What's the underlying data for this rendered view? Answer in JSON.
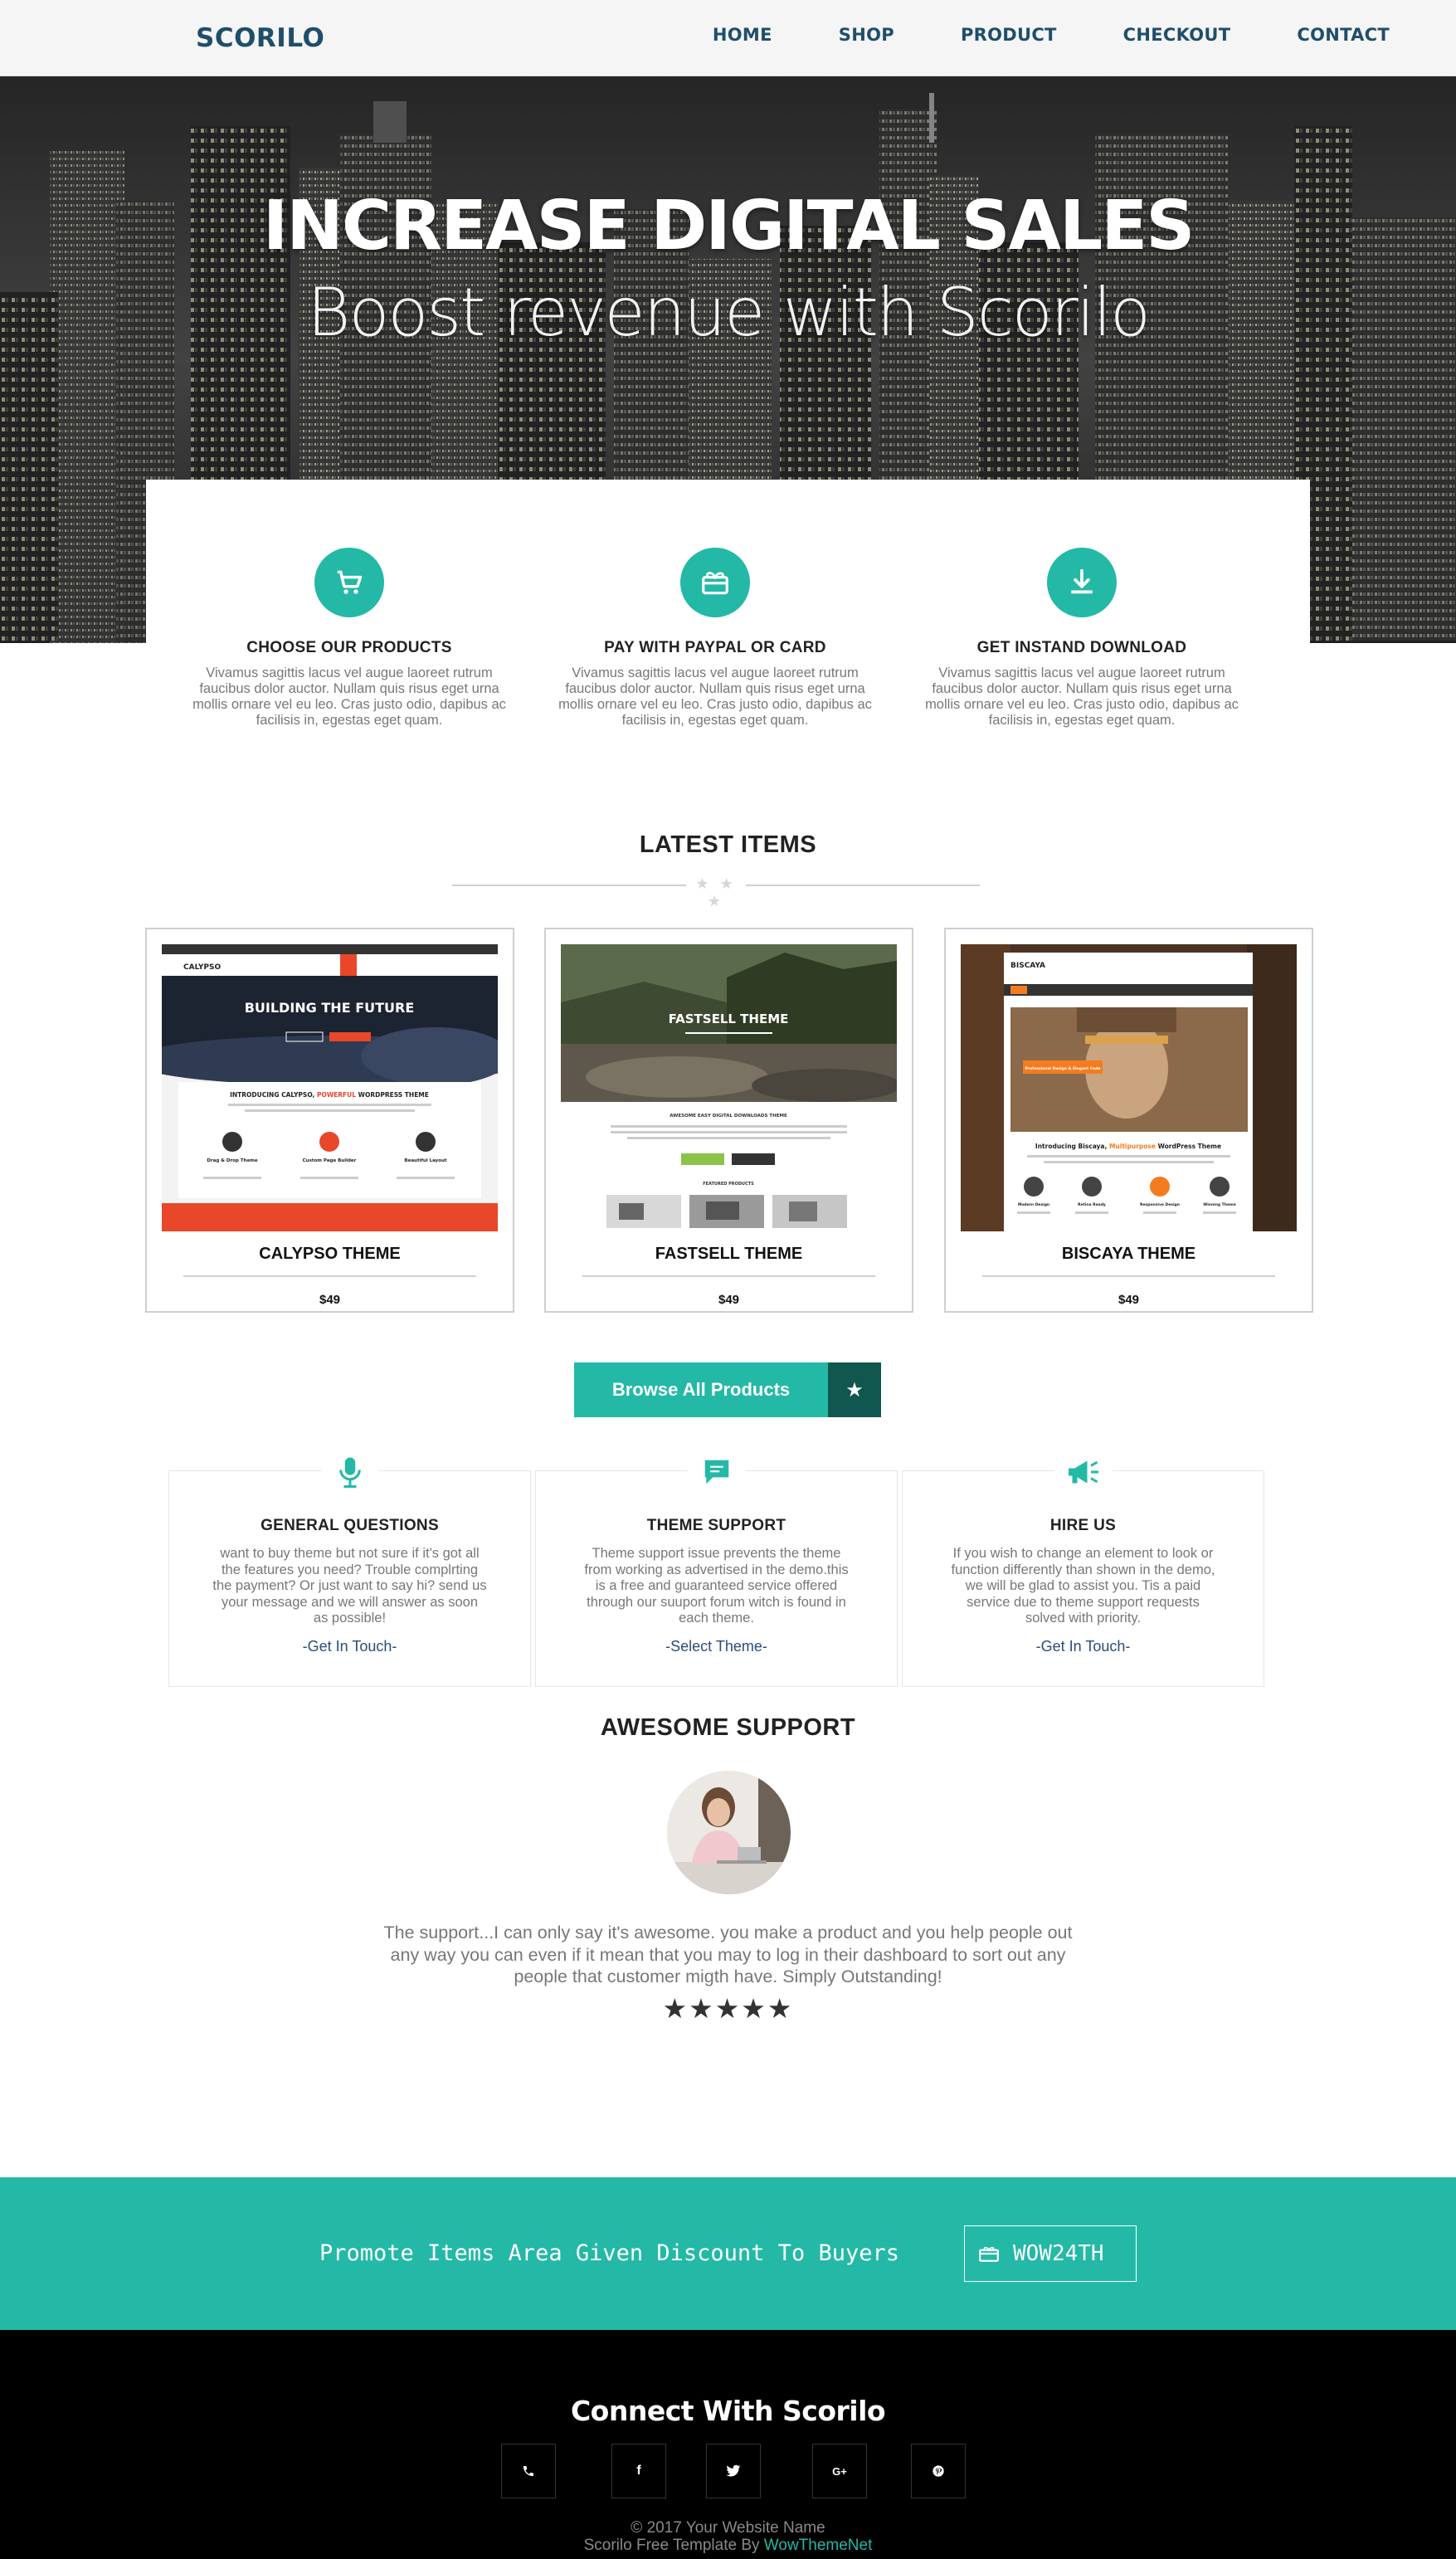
{
  "nav": {
    "brand": "SCORILO",
    "items": [
      "HOME",
      "SHOP",
      "PRODUCT",
      "CHECKOUT",
      "CONTACT"
    ]
  },
  "hero": {
    "title": "INCREASE DIGITAL SALES",
    "subtitle": "Boost revenue with Scorilo"
  },
  "features": [
    {
      "icon": "cart-icon",
      "title": "CHOOSE OUR PRODUCTS",
      "text": "Vivamus sagittis lacus vel augue laoreet rutrum faucibus dolor auctor. Nullam quis risus eget urna mollis ornare vel eu leo. Cras justo odio, dapibus ac facilisis in, egestas eget quam."
    },
    {
      "icon": "gift-icon",
      "title": "PAY WITH PAYPAL OR CARD",
      "text": "Vivamus sagittis lacus vel augue laoreet rutrum faucibus dolor auctor. Nullam quis risus eget urna mollis ornare vel eu leo. Cras justo odio, dapibus ac facilisis in, egestas eget quam."
    },
    {
      "icon": "download-icon",
      "title": "GET INSTAND DOWNLOAD",
      "text": "Vivamus sagittis lacus vel augue laoreet rutrum faucibus dolor auctor. Nullam quis risus eget urna mollis ornare vel eu leo. Cras justo odio, dapibus ac facilisis in, egestas eget quam."
    }
  ],
  "latest": {
    "title": "LATEST ITEMS",
    "stars": "★ ★ ★",
    "products": [
      {
        "name": "CALYPSO THEME",
        "price": "$49",
        "preview": {
          "logo": "CALYPSO",
          "banner": "BUILDING THE FUTURE",
          "heading_pre": "INTRODUCING CALYPSO, ",
          "heading_hl": "POWERFUL",
          "heading_post": " WORDPRESS THEME",
          "blocks": [
            "Drag & Drop Theme",
            "Custom Page Builder",
            "Beautiful Layout"
          ]
        }
      },
      {
        "name": "FASTSELL THEME",
        "price": "$49",
        "preview": {
          "banner": "FASTSELL THEME",
          "heading": "AWESOME EASY DIGITAL DOWNLOADS THEME",
          "section": "FEATURED PRODUCTS"
        }
      },
      {
        "name": "BISCAYA THEME",
        "price": "$49",
        "preview": {
          "logo": "BISCAYA",
          "ribbon": "Professional Design & Elegant Code",
          "heading_pre": "Introducing Biscaya, ",
          "heading_hl": "Multipurpose",
          "heading_post": " WordPress Theme",
          "blocks": [
            "Modern Design",
            "Retina Ready",
            "Responsive Design",
            "Winning Theme"
          ]
        }
      }
    ]
  },
  "browse": {
    "label": "Browse All Products",
    "icon": "star-icon"
  },
  "support_boxes": [
    {
      "icon": "microphone-icon",
      "title": "GENERAL QUESTIONS",
      "text": "want to buy theme but not sure if it's got all the features you need? Trouble complrting the payment? Or just want to say hi? send us your message and we will answer as soon as possible!",
      "link": "-Get In Touch-"
    },
    {
      "icon": "chat-icon",
      "title": "THEME SUPPORT",
      "text": "Theme support issue prevents the theme from working as advertised in the demo.this is a free and guaranteed service offered through our suuport forum witch is found in each theme.",
      "link": "-Select Theme-"
    },
    {
      "icon": "megaphone-icon",
      "title": "HIRE US",
      "text": "If you wish to change an element to look or function differently than shown in the demo, we will be glad to assist you. Tis a paid service due to theme support requests solved with priority.",
      "link": "-Get In Touch-"
    }
  ],
  "testimonial": {
    "title": "AWESOME SUPPORT",
    "quote": "The support...I can only say it's awesome. you make a product and you help people out any way you can even if it mean that you may to log in their dashboard to sort out any people that customer migth have. Simply Outstanding!",
    "rating_stars": "★★★★★",
    "rating_value": 5
  },
  "promo": {
    "text": "Promote Items Area Given Discount To Buyers",
    "coupon": "WOW24TH"
  },
  "footer": {
    "title": "Connect With Scorilo",
    "socials": [
      {
        "icon": "phone-icon",
        "glyph": "✆"
      },
      {
        "icon": "facebook-icon",
        "glyph": "f"
      },
      {
        "icon": "twitter-icon",
        "glyph": ""
      },
      {
        "icon": "google-plus-icon",
        "glyph": "G+"
      },
      {
        "icon": "pinterest-icon",
        "glyph": "℗"
      }
    ],
    "copyright": "© 2017 Your Website Name",
    "credit_pre": "Scorilo Free Template By ",
    "credit_link": "WowThemeNet"
  },
  "colors": {
    "accent": "#23b9a6",
    "accent_dark": "#10584f",
    "nav_text": "#1f4e6b",
    "footer_bg": "#000000"
  }
}
